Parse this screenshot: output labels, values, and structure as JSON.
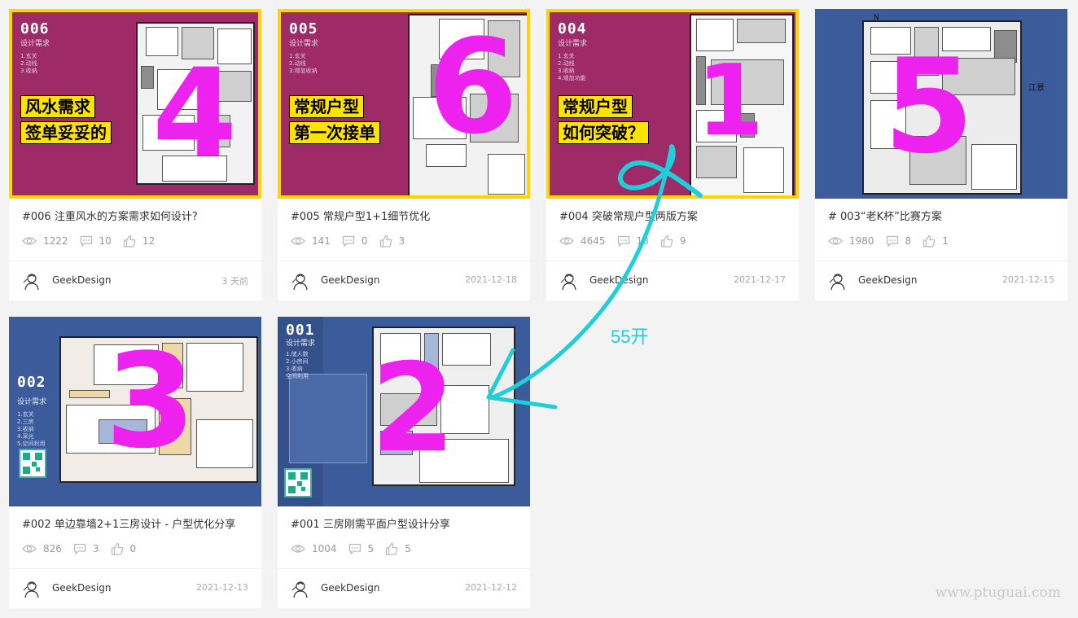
{
  "cards": [
    {
      "title": "#006 注重风水的方案需求如何设计?",
      "views": "1222",
      "comments": "10",
      "likes": "12",
      "author": "GeekDesign",
      "date": "3 天前",
      "thumb": {
        "code": "006",
        "subtitle": "设计需求",
        "lines": "1.玄关\n2.动线\n3.收纳",
        "badge1": "风水需求",
        "badge2": "签单妥妥的",
        "hand": "4"
      }
    },
    {
      "title": "#005 常规户型1+1细节优化",
      "views": "141",
      "comments": "0",
      "likes": "3",
      "author": "GeekDesign",
      "date": "2021-12-18",
      "thumb": {
        "code": "005",
        "subtitle": "设计需求",
        "lines": "1.玄关\n2.动线\n3.增加收纳",
        "badge1": "常规户型",
        "badge2": "第一次接单",
        "hand": "6"
      }
    },
    {
      "title": "#004 突破常规户型两版方案",
      "views": "4645",
      "comments": "18",
      "likes": "9",
      "author": "GeekDesign",
      "date": "2021-12-17",
      "thumb": {
        "code": "004",
        "subtitle": "设计需求",
        "lines": "1.玄关\n2.动线\n3.收纳\n4.增加功能",
        "badge1": "常规户型",
        "badge2": "如何突破？",
        "hand": "1"
      }
    },
    {
      "title": "# 003“老K杯”比赛方案",
      "views": "1980",
      "comments": "8",
      "likes": "1",
      "author": "GeekDesign",
      "date": "2021-12-15",
      "thumb": {
        "north": "N",
        "label": "江景",
        "hand": "5"
      }
    },
    {
      "title": "#002 单边靠墙2+1三房设计 - 户型优化分享",
      "views": "826",
      "comments": "3",
      "likes": "0",
      "author": "GeekDesign",
      "date": "2021-12-13",
      "thumb": {
        "code": "002",
        "subtitle": "设计需求",
        "lines": "1.玄关\n2.三房\n3.收纳\n4.采光\n5.空间利用",
        "hand": "3"
      }
    },
    {
      "title": "#001 三房刚需平面户型设计分享",
      "views": "1004",
      "comments": "5",
      "likes": "5",
      "author": "GeekDesign",
      "date": "2021-12-12",
      "thumb": {
        "code": "001",
        "subtitle": "设计需求",
        "lines": "1.储人数\n2.小房间\n3.收纳\n空间利用",
        "hand": "2"
      }
    }
  ],
  "annotation": {
    "text": "55开",
    "color": "#1fcfd8"
  },
  "watermark": "www.ptuguai.com",
  "colors": {
    "magenta_bg": "#9e2a68",
    "blue_bg": "#3c5b9a",
    "badge_yellow": "#ffe300",
    "hand_pink": "#ee22ee",
    "annot_cyan": "#1fcfd8"
  }
}
